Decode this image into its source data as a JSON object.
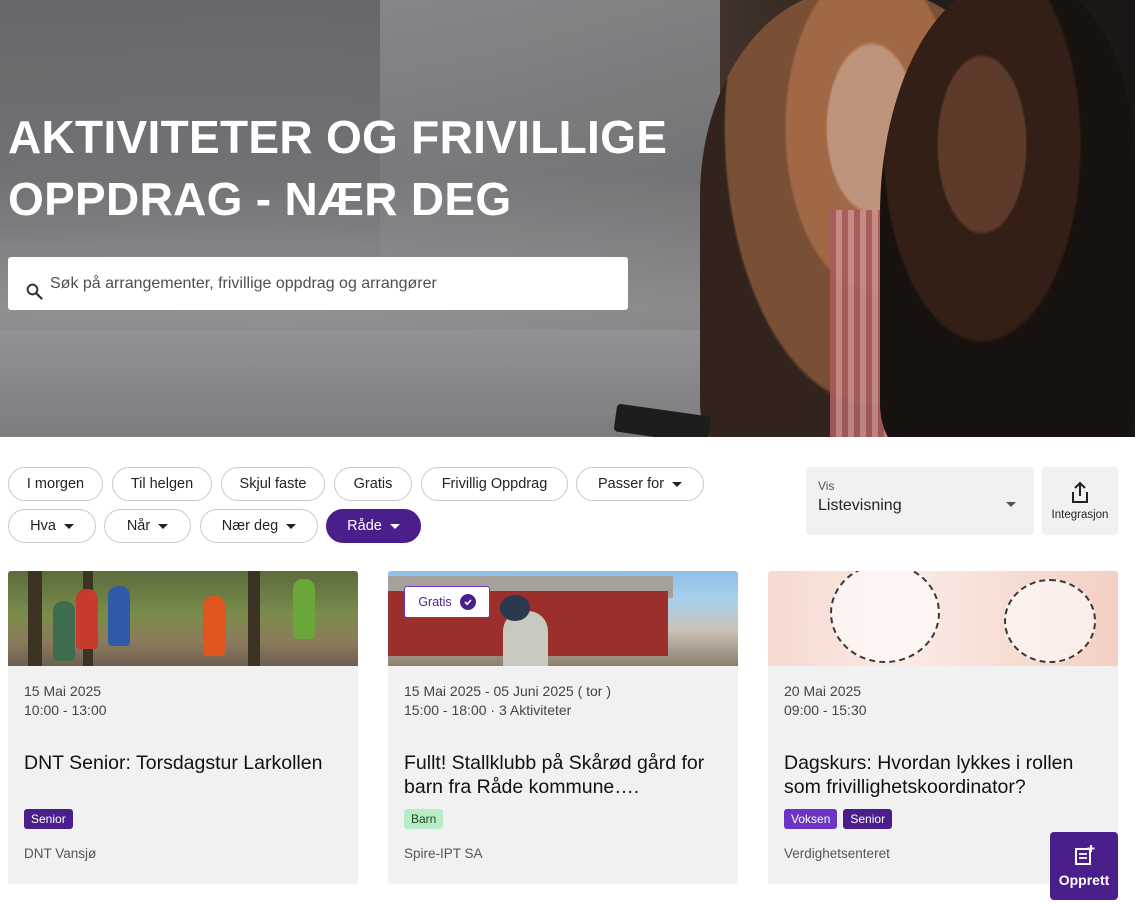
{
  "hero": {
    "title_line1": "AKTIVITETER OG FRIVILLIGE",
    "title_line2": "OPPDRAG - NÆR DEG"
  },
  "search": {
    "placeholder": "Søk på arrangementer, frivillige oppdrag og arrangører"
  },
  "filters": {
    "row1": [
      "I morgen",
      "Til helgen",
      "Skjul faste",
      "Gratis",
      "Frivillig Oppdrag",
      "Passer for"
    ],
    "row2": [
      "Hva",
      "Når",
      "Nær deg",
      "Råde"
    ]
  },
  "view": {
    "label": "Vis",
    "value": "Listevisning"
  },
  "integration": {
    "label": "Integrasjon"
  },
  "cards": [
    {
      "date_line1": "15 Mai 2025",
      "date_line2": "10:00 - 13:00",
      "title": "DNT Senior: Torsdagstur Larkollen",
      "tags": [
        "Senior"
      ],
      "organizer": "DNT Vansjø"
    },
    {
      "badge": "Gratis",
      "date_line1": "15 Mai 2025 - 05 Juni 2025 ( tor )",
      "date_line2": "15:00 - 18:00  ·  3  Aktiviteter",
      "title": "Fullt! Stallklubb på Skårød gård for barn fra Råde kommune….",
      "tags": [
        "Barn"
      ],
      "organizer": "Spire-IPT SA"
    },
    {
      "date_line1": "20 Mai 2025",
      "date_line2": "09:00 - 15:30",
      "title": "Dagskurs: Hvordan lykkes i rollen som frivillighetskoordinator?",
      "tags": [
        "Voksen",
        "Senior"
      ],
      "organizer": "Verdighetsenteret"
    }
  ],
  "fab": {
    "label": "Opprett"
  },
  "colors": {
    "primary": "#4a1f8c",
    "tag_voksen": "#6a35c4",
    "tag_barn": "#b7ecc7",
    "card_bg": "#f1f1f1"
  }
}
